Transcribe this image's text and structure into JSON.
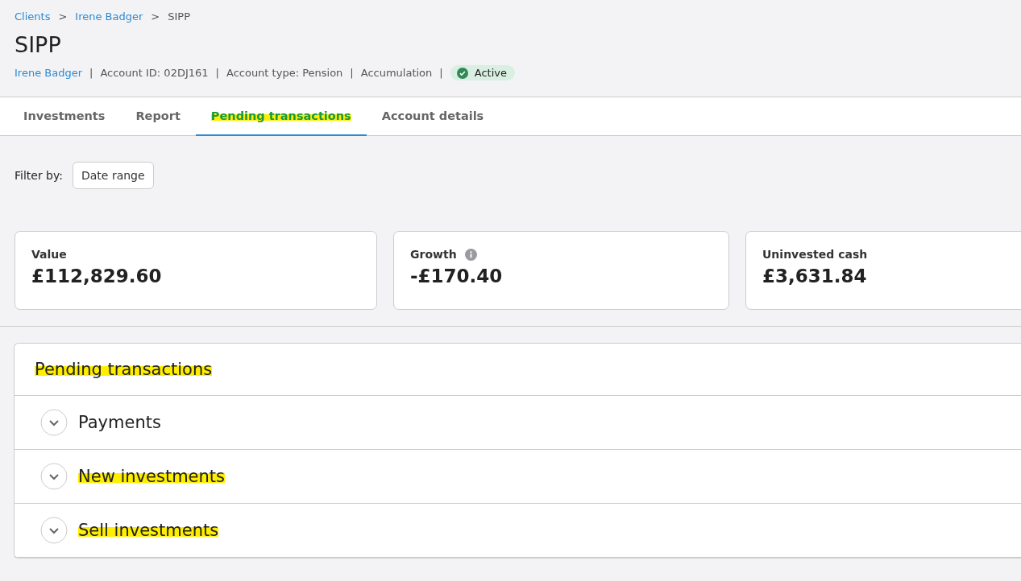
{
  "breadcrumbs": [
    {
      "label": "Clients",
      "link": true
    },
    {
      "label": "Irene Badger",
      "link": true
    },
    {
      "label": "SIPP",
      "link": false
    }
  ],
  "breadcrumb_separator": ">",
  "title": "SIPP",
  "meta": [
    {
      "text": "Irene Badger",
      "link": true
    },
    {
      "text": "Account ID: 02DJ161",
      "link": false
    },
    {
      "text": "Account type: Pension",
      "link": false
    },
    {
      "text": "Accumulation",
      "link": false
    }
  ],
  "meta_separator": "|",
  "status": {
    "label": "Active"
  },
  "tabs": [
    {
      "label": "Investments",
      "selected": false,
      "highlighted": false
    },
    {
      "label": "Report",
      "selected": false,
      "highlighted": false
    },
    {
      "label": "Pending transactions",
      "selected": true,
      "highlighted": true
    },
    {
      "label": "Account details",
      "selected": false,
      "highlighted": false
    }
  ],
  "filter": {
    "label": "Filter by:",
    "button": "Date range"
  },
  "stats": [
    {
      "label": "Value",
      "value": "£112,829.60",
      "info": false
    },
    {
      "label": "Growth",
      "value": "-£170.40",
      "info": true
    },
    {
      "label": "Uninvested cash",
      "value": "£3,631.84",
      "info": false
    }
  ],
  "panel": {
    "title": "Pending transactions",
    "highlighted": true,
    "sections": [
      {
        "label": "Payments",
        "expanded": false,
        "highlighted": false
      },
      {
        "label": "New investments",
        "expanded": false,
        "highlighted": true
      },
      {
        "label": "Sell investments",
        "expanded": false,
        "highlighted": true
      }
    ]
  }
}
